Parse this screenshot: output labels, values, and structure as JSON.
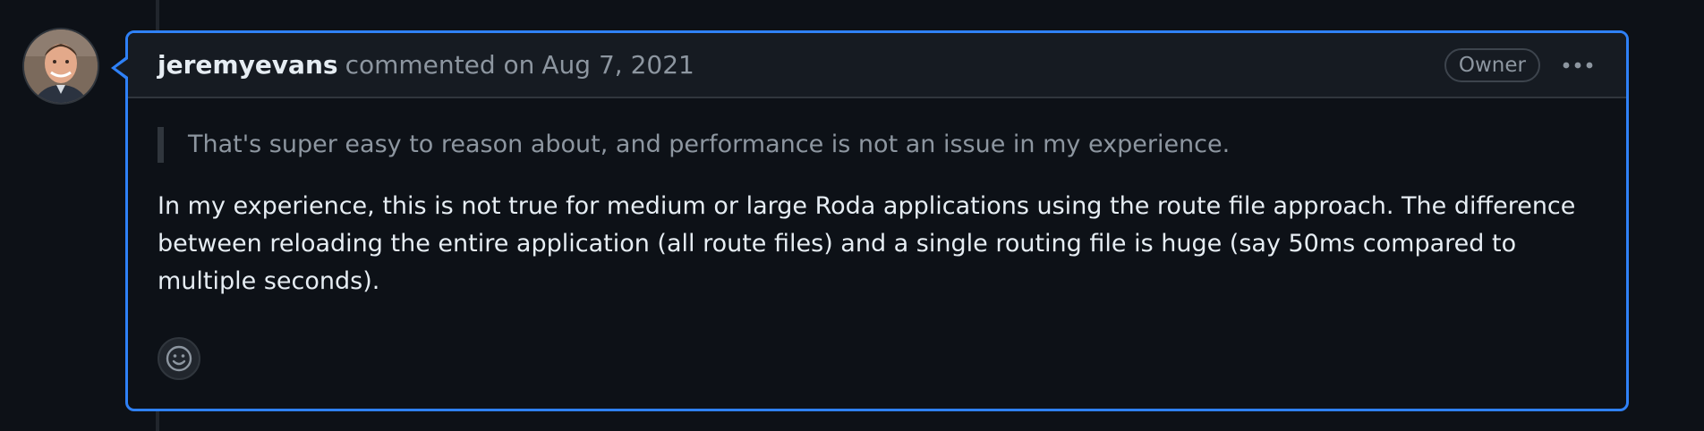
{
  "comment": {
    "author": "jeremyevans",
    "action": "commented on",
    "date": "Aug 7, 2021",
    "role_badge": "Owner",
    "menu_icon": "kebab-horizontal-icon",
    "quote": "That's super easy to reason about, and performance is not an issue in my experience.",
    "body": "In my experience, this is not true for medium or large Roda applications using the route file approach. The difference between reloading the entire application (all route files) and a single routing file is huge (say 50ms compared to multiple seconds).",
    "reaction_icon": "smiley-icon"
  },
  "colors": {
    "background": "#0d1117",
    "header_background": "#161b22",
    "highlight_border": "#2f81f7",
    "muted_text": "#8d96a0",
    "primary_text": "#e6edf3"
  }
}
